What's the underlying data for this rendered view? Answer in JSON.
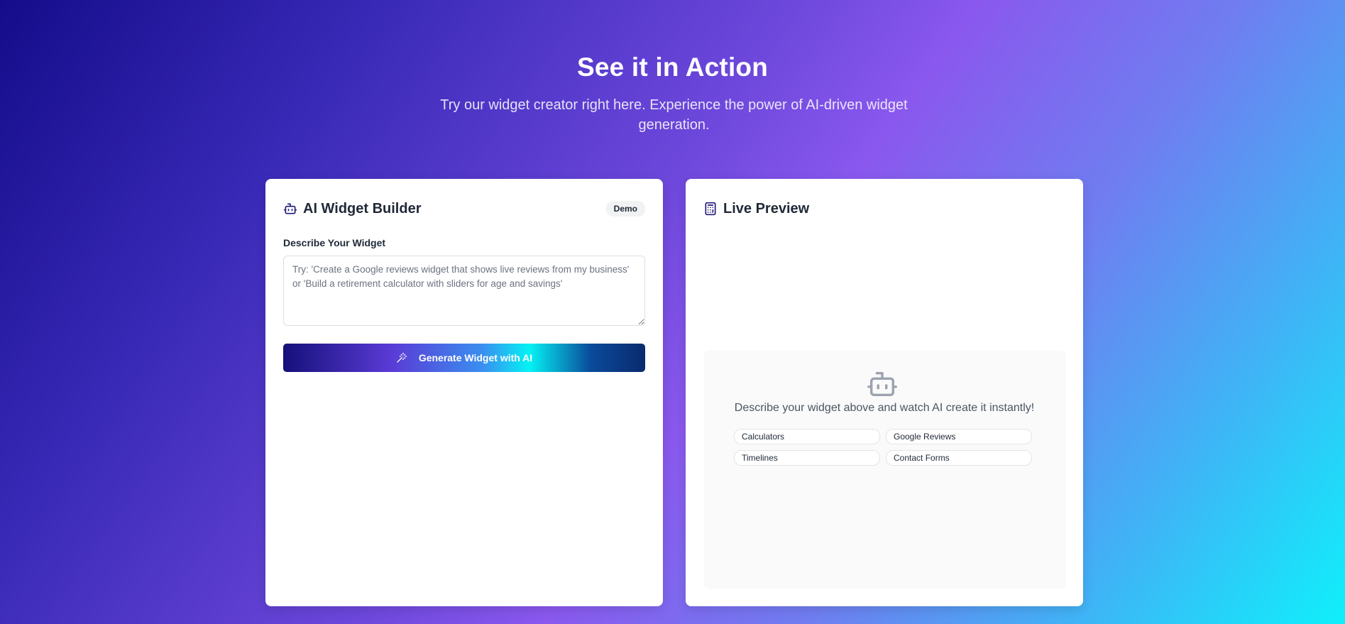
{
  "hero": {
    "title": "See it in Action",
    "subtitle": "Try our widget creator right here. Experience the power of AI-driven widget generation."
  },
  "builder": {
    "title": "AI Widget Builder",
    "badge": "Demo",
    "field_label": "Describe Your Widget",
    "placeholder": "Try: 'Create a Google reviews widget that shows live reviews from my business' or 'Build a retirement calculator with sliders for age and savings'",
    "button_label": "Generate Widget with AI"
  },
  "preview": {
    "title": "Live Preview",
    "message": "Describe your widget above and watch AI create it instantly!",
    "chips": [
      "Calculators",
      "Google Reviews",
      "Timelines",
      "Contact Forms"
    ]
  },
  "icons": {
    "builder": "robot-icon",
    "preview": "calculator-icon",
    "button": "magic-wand-icon",
    "empty_state": "robot-icon"
  }
}
